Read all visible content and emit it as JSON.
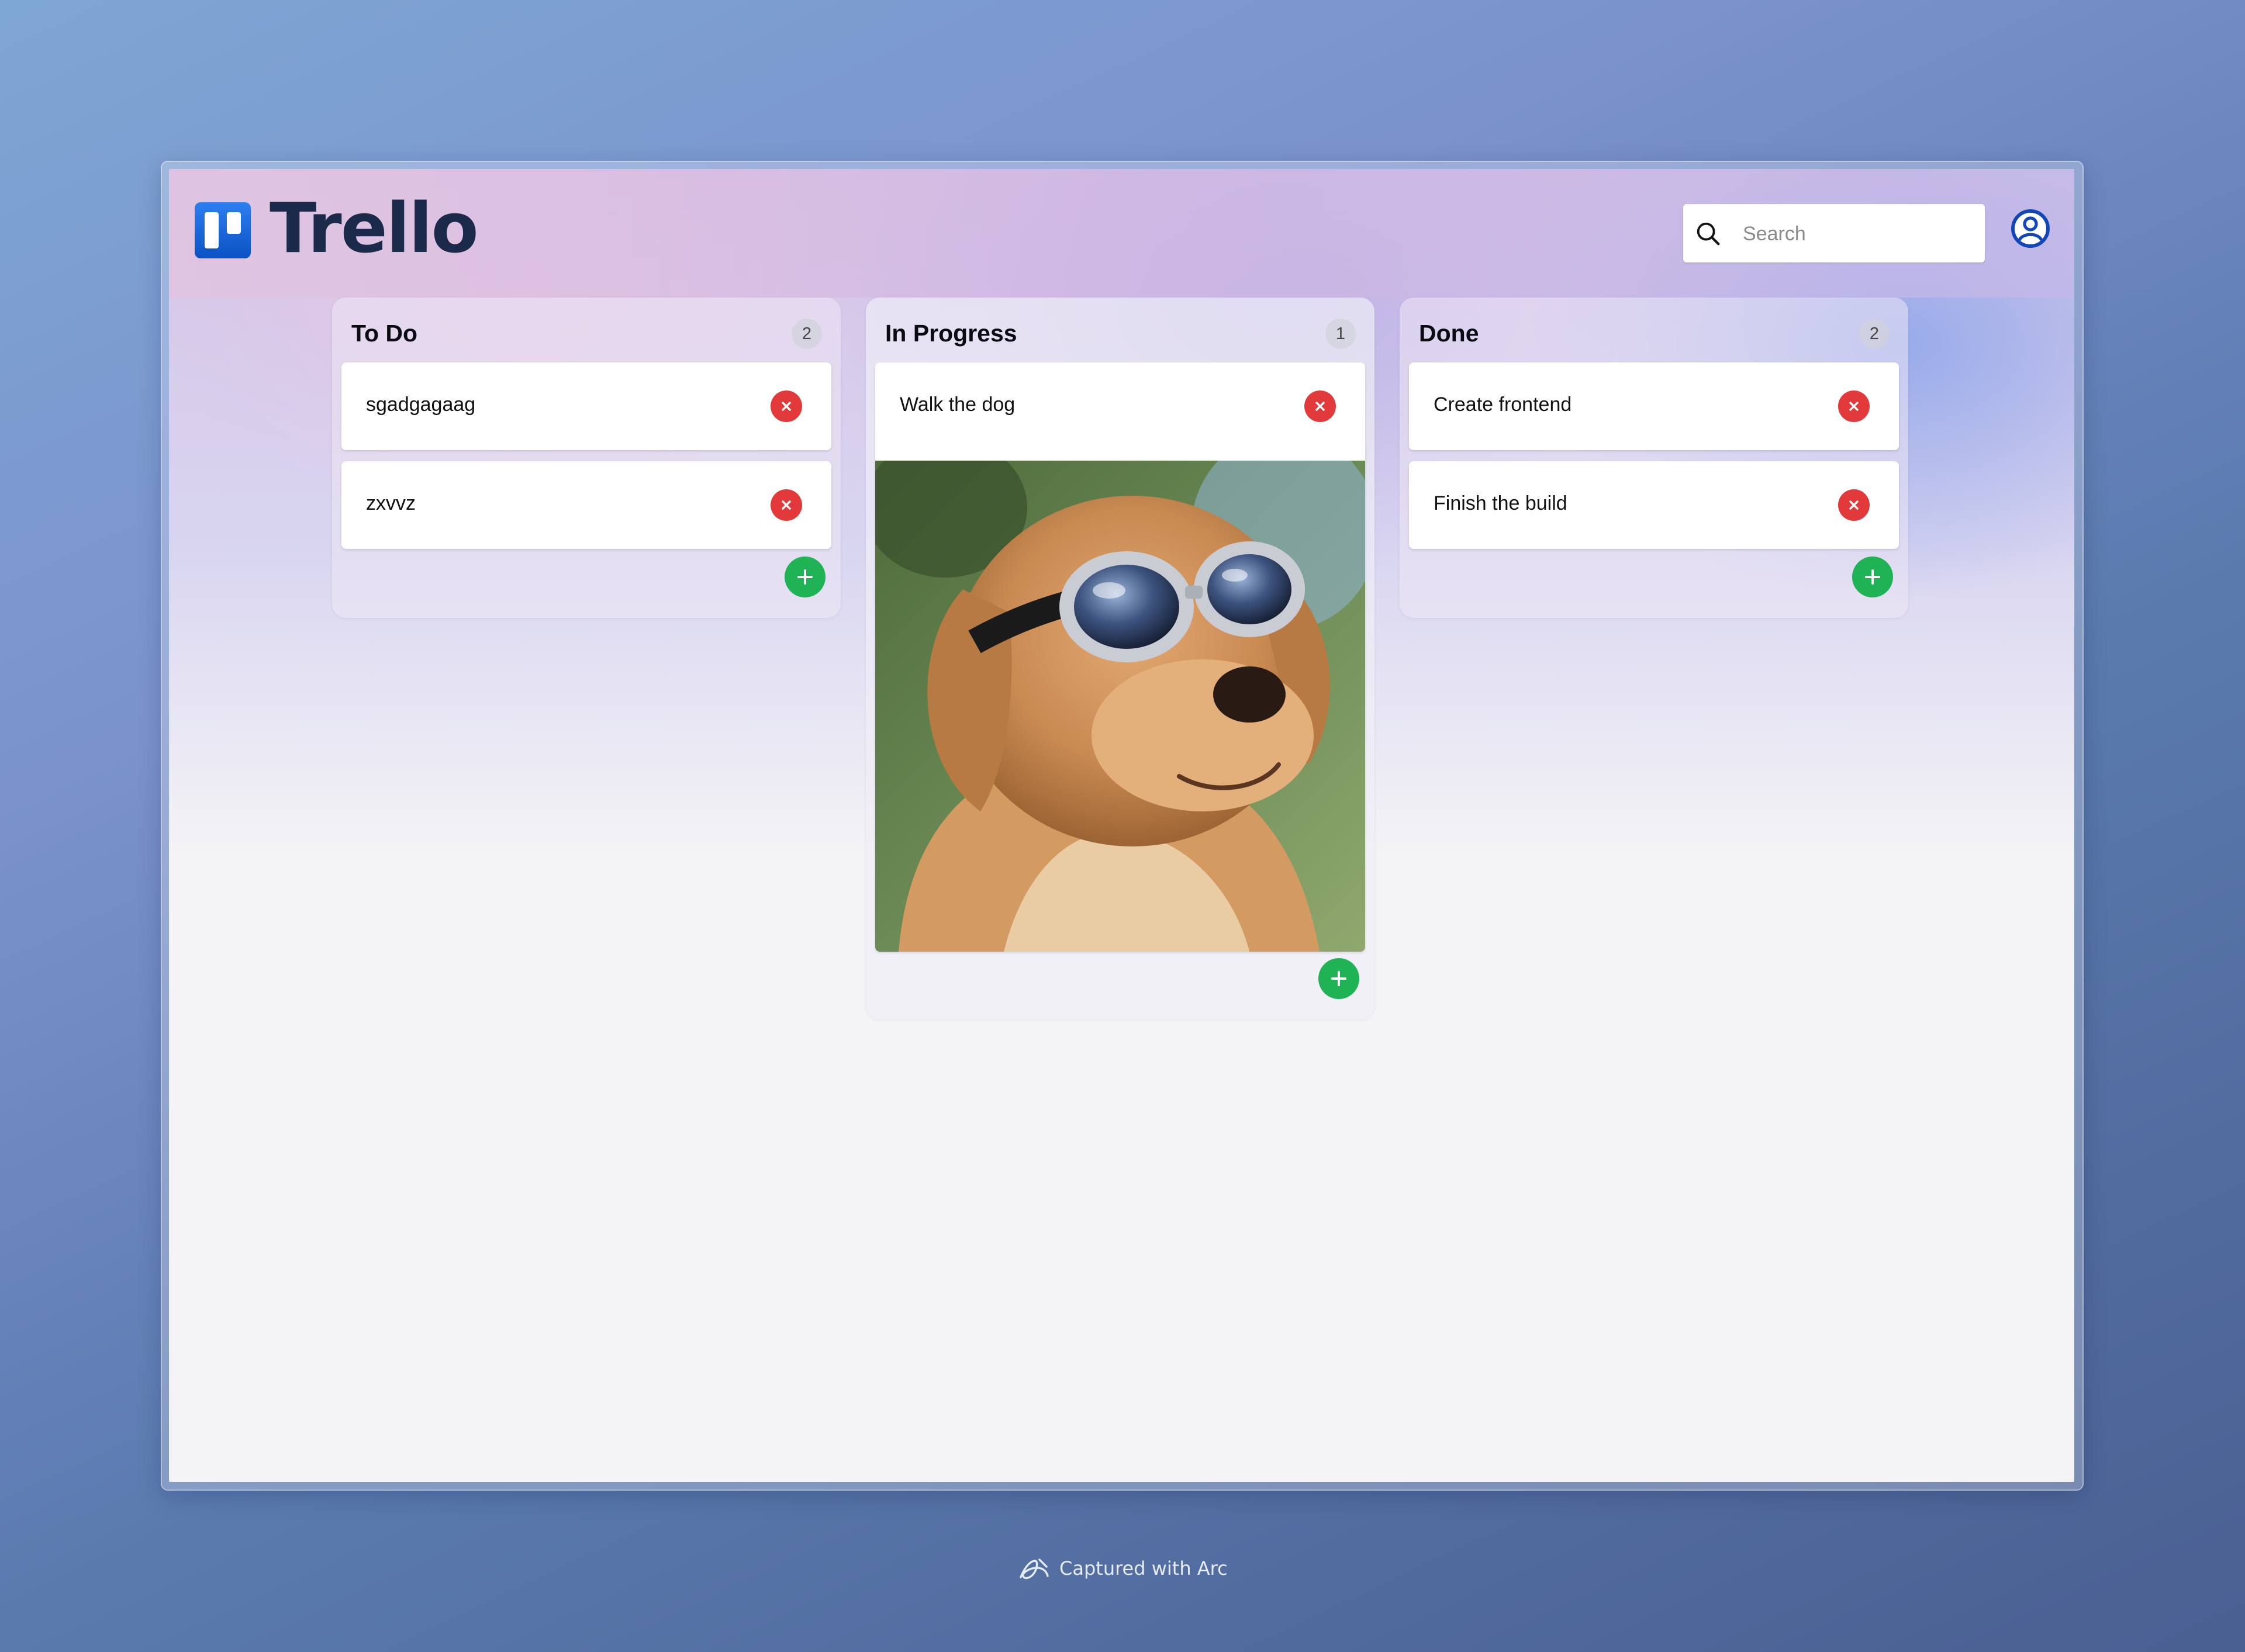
{
  "app": {
    "brand_name": "Trello",
    "brand_color": "#0b52c4"
  },
  "header": {
    "search_placeholder": "Search",
    "search_value": ""
  },
  "board": {
    "columns": [
      {
        "title": "To Do",
        "count": "2",
        "cards": [
          {
            "text": "sgadgagaag"
          },
          {
            "text": "zxvvz"
          }
        ]
      },
      {
        "title": "In Progress",
        "count": "1",
        "cards": [
          {
            "text": "Walk the dog",
            "image": "golden-retriever-with-goggles"
          }
        ]
      },
      {
        "title": "Done",
        "count": "2",
        "cards": [
          {
            "text": "Create frontend"
          },
          {
            "text": "Finish the build"
          }
        ]
      }
    ]
  },
  "colors": {
    "delete": "#e23a3a",
    "add": "#1fb356"
  },
  "icons": {
    "search": "search-icon",
    "profile": "user-circle-icon",
    "delete": "close-icon",
    "add": "plus-icon"
  },
  "footer": {
    "text": "Captured with Arc"
  }
}
